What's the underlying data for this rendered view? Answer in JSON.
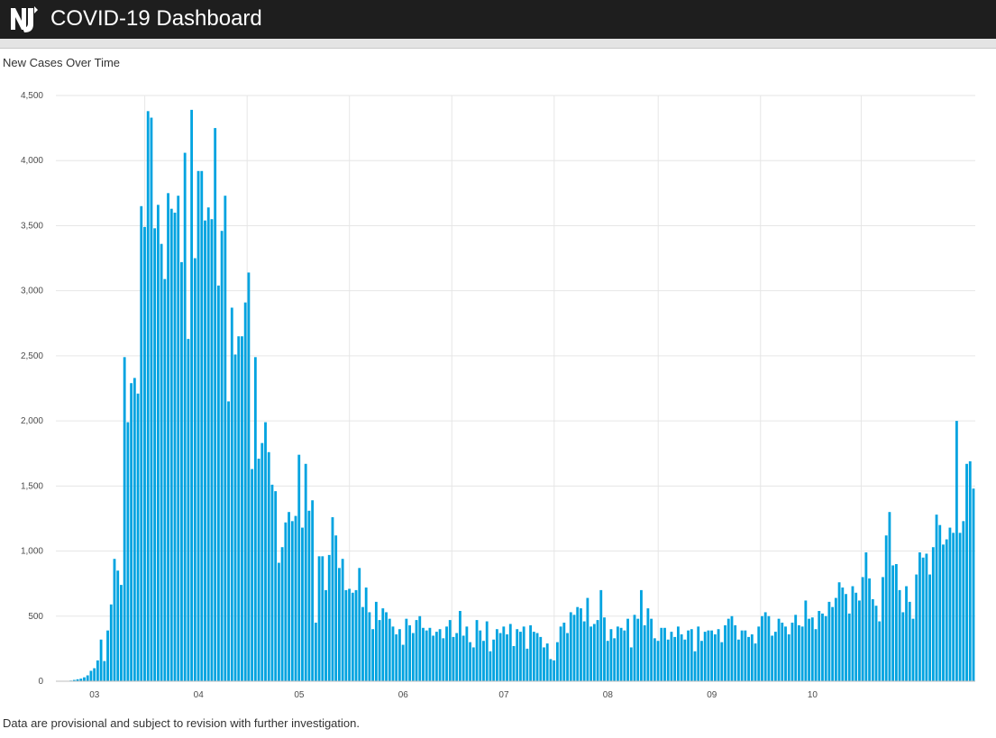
{
  "header": {
    "title": "COVID-19 Dashboard",
    "logo_icon": "nj-state-logo-icon"
  },
  "panel": {
    "title": "New Cases Over Time",
    "footnote": "Data are provisional and subject to revision with further investigation."
  },
  "colors": {
    "bar": "#00a3e0",
    "grid": "#e6e6e6",
    "header_bg": "#1e1e1e"
  },
  "chart_data": {
    "type": "bar",
    "grid": true,
    "ylim": [
      0,
      4500
    ],
    "yticks": [
      0,
      500,
      1000,
      1500,
      2000,
      2500,
      3000,
      3500,
      4000,
      4500
    ],
    "ytick_labels": [
      "0",
      "500",
      "1,000",
      "1,500",
      "2,000",
      "2,500",
      "3,000",
      "3,500",
      "4,000",
      "4,500"
    ],
    "xticks": [
      {
        "label": "03",
        "index": 11
      },
      {
        "label": "04",
        "index": 42
      },
      {
        "label": "05",
        "index": 72
      },
      {
        "label": "06",
        "index": 103
      },
      {
        "label": "07",
        "index": 133
      },
      {
        "label": "08",
        "index": 164
      },
      {
        "label": "09",
        "index": 195
      },
      {
        "label": "10",
        "index": 225
      }
    ],
    "values": [
      0,
      0,
      0,
      0,
      5,
      10,
      15,
      20,
      30,
      45,
      80,
      100,
      160,
      320,
      155,
      390,
      590,
      940,
      850,
      740,
      2490,
      1990,
      2290,
      2330,
      2210,
      3650,
      3490,
      4380,
      4330,
      3480,
      3660,
      3360,
      3090,
      3750,
      3630,
      3600,
      3730,
      3220,
      4060,
      2630,
      4390,
      3250,
      3920,
      3920,
      3540,
      3640,
      3550,
      4250,
      3040,
      3460,
      3730,
      2150,
      2870,
      2510,
      2650,
      2650,
      2910,
      3140,
      1630,
      2490,
      1710,
      1830,
      1990,
      1760,
      1510,
      1460,
      910,
      1030,
      1220,
      1300,
      1230,
      1270,
      1740,
      1180,
      1670,
      1310,
      1390,
      450,
      960,
      960,
      700,
      970,
      1260,
      1120,
      870,
      940,
      700,
      710,
      680,
      700,
      870,
      570,
      720,
      530,
      400,
      610,
      470,
      560,
      530,
      480,
      420,
      360,
      400,
      280,
      480,
      430,
      370,
      470,
      500,
      410,
      390,
      410,
      350,
      380,
      400,
      330,
      420,
      470,
      340,
      370,
      540,
      350,
      420,
      300,
      260,
      470,
      390,
      310,
      460,
      230,
      320,
      400,
      370,
      420,
      360,
      440,
      270,
      400,
      380,
      420,
      250,
      430,
      380,
      370,
      340,
      260,
      290,
      170,
      160,
      300,
      420,
      450,
      370,
      530,
      510,
      570,
      560,
      460,
      640,
      420,
      440,
      470,
      700,
      490,
      310,
      400,
      330,
      420,
      410,
      390,
      480,
      260,
      510,
      480,
      700,
      430,
      560,
      480,
      330,
      310,
      410,
      410,
      320,
      380,
      340,
      420,
      360,
      320,
      390,
      400,
      230,
      420,
      310,
      380,
      390,
      390,
      360,
      400,
      300,
      430,
      480,
      500,
      430,
      320,
      390,
      390,
      340,
      360,
      290,
      420,
      500,
      530,
      500,
      350,
      380,
      480,
      450,
      420,
      360,
      450,
      510,
      430,
      420,
      620,
      480,
      490,
      400,
      540,
      520,
      500,
      610,
      570,
      640,
      760,
      720,
      670,
      520,
      730,
      680,
      620,
      800,
      990,
      790,
      630,
      580,
      460,
      800,
      1120,
      1300,
      890,
      900,
      700,
      530,
      730,
      610,
      480,
      820,
      990,
      950,
      980,
      820,
      1030,
      1280,
      1200,
      1050,
      1090,
      1180,
      1140,
      2000,
      1140,
      1230,
      1670,
      1690,
      1480
    ]
  }
}
